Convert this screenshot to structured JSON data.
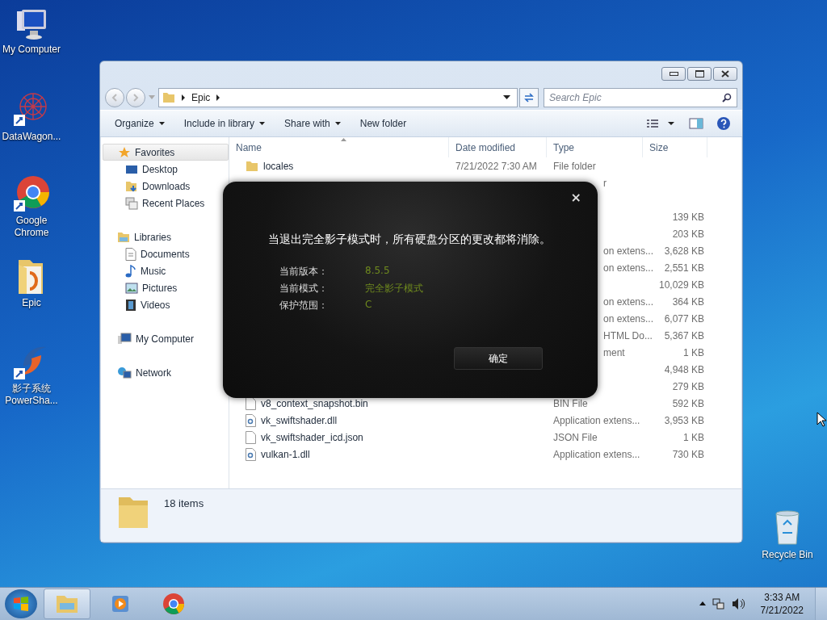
{
  "desktop_icons": [
    {
      "label": "My Computer",
      "kind": "computer"
    },
    {
      "label": "DataWagon...",
      "kind": "web"
    },
    {
      "label": "Google\nChrome",
      "kind": "chrome"
    },
    {
      "label": "Epic",
      "kind": "folder"
    },
    {
      "label": "影子系统\nPowerSha...",
      "kind": "swirl"
    },
    {
      "label": "Recycle Bin",
      "kind": "bin"
    }
  ],
  "window": {
    "breadcrumb": [
      "Epic"
    ],
    "search": {
      "placeholder": "Search Epic"
    },
    "toolbar": [
      {
        "label": "Organize",
        "menu": true
      },
      {
        "label": "Include in library",
        "menu": true
      },
      {
        "label": "Share with",
        "menu": true
      },
      {
        "label": "New folder",
        "menu": false
      }
    ],
    "nav": [
      {
        "label": "Favorites",
        "kind": "star",
        "selected": true,
        "children": [
          {
            "label": "Desktop",
            "kind": "desktop",
            "selected": false
          },
          {
            "label": "Downloads",
            "kind": "downloads",
            "selected": false
          },
          {
            "label": "Recent Places",
            "kind": "recent",
            "selected": false
          }
        ]
      },
      {
        "label": "Libraries",
        "kind": "library",
        "selected": false,
        "children": [
          {
            "label": "Documents",
            "kind": "doc",
            "selected": false
          },
          {
            "label": "Music",
            "kind": "music",
            "selected": false
          },
          {
            "label": "Pictures",
            "kind": "pictures",
            "selected": false
          },
          {
            "label": "Videos",
            "kind": "videos",
            "selected": false
          }
        ]
      },
      {
        "label": "My Computer",
        "kind": "computer",
        "selected": false
      },
      {
        "label": "Network",
        "kind": "network",
        "selected": false
      }
    ],
    "columns": [
      "Name",
      "Date modified",
      "Type",
      "Size"
    ],
    "rows": [
      {
        "kind": "folder",
        "name": "locales",
        "date": "7/21/2022 7:30 AM",
        "type": "File folder"
      },
      {
        "type_part": "r"
      },
      {},
      {
        "size": "139 KB"
      },
      {
        "size": "203 KB"
      },
      {
        "type_part": "on extens...",
        "size": "3,628 KB"
      },
      {
        "type_part": "on extens...",
        "size": "2,551 KB"
      },
      {
        "size": "10,029 KB"
      },
      {
        "type_part": "on extens...",
        "size": "364 KB"
      },
      {
        "type_part": "on extens...",
        "size": "6,077 KB"
      },
      {
        "type_part": "HTML Do...",
        "size": "5,367 KB"
      },
      {
        "type_part": "ment",
        "size": "1 KB"
      },
      {
        "size": "4,948 KB"
      },
      {
        "size": "279 KB"
      },
      {
        "kind": "file",
        "name": "v8_context_snapshot.bin",
        "type": "BIN File",
        "size": "592 KB"
      },
      {
        "kind": "dll",
        "name": "vk_swiftshader.dll",
        "type": "Application extens...",
        "size": "3,953 KB"
      },
      {
        "kind": "file",
        "name": "vk_swiftshader_icd.json",
        "type": "JSON File",
        "size": "1 KB"
      },
      {
        "kind": "dll",
        "name": "vulkan-1.dll",
        "type": "Application extens...",
        "size": "730 KB"
      }
    ],
    "status": "18 items"
  },
  "dialog": {
    "close": "×",
    "message": "当退出完全影子模式时，所有硬盘分区的更改都将消除。",
    "fields": [
      {
        "label": "当前版本：",
        "value": "8.5.5"
      },
      {
        "label": "当前模式：",
        "value": "完全影子模式"
      },
      {
        "label": "保护范围：",
        "value": "C"
      }
    ],
    "button": "确定"
  },
  "taskbar": {
    "apps": [
      {
        "kind": "explorer",
        "selected": true
      },
      {
        "kind": "media",
        "selected": false
      },
      {
        "kind": "chrome",
        "selected": false
      }
    ],
    "time": "3:33 AM",
    "date": "7/21/2022"
  }
}
